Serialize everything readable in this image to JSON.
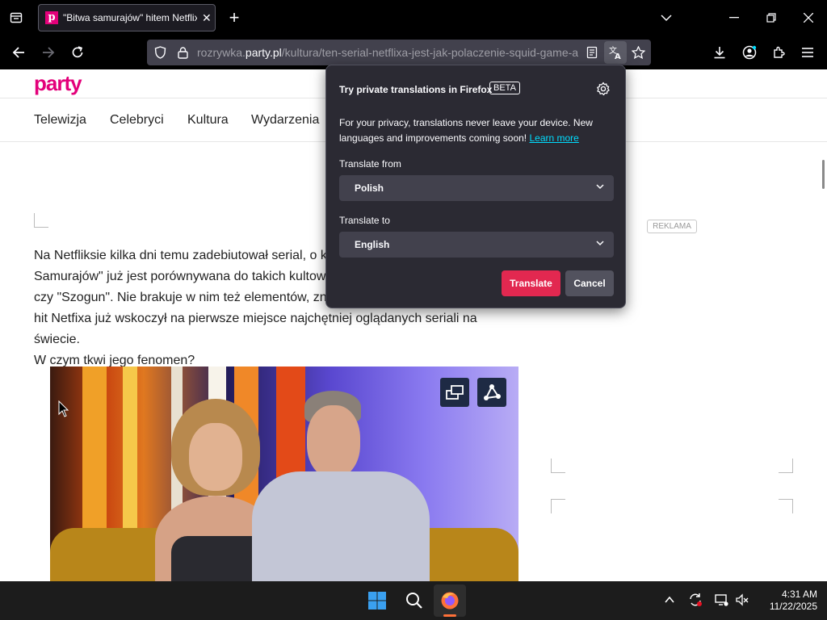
{
  "browser": {
    "tab": {
      "title": "\"Bitwa samurajów\" hitem Netflix",
      "favicon": "p"
    },
    "url": {
      "prefix": "rozrywka.",
      "domain": "party.pl",
      "path": "/kultura/ten-serial-netflixa-jest-jak-polaczenie-squid-game-a"
    }
  },
  "site": {
    "logo": "party",
    "nav": [
      "Telewizja",
      "Celebryci",
      "Kultura",
      "Wydarzenia"
    ],
    "ad_label": "REKLAMA",
    "article_lines": [
      "Na Netfliksie kilka dni temu zadebiutował serial, o k",
      "Samurajów\" już jest porównywana do takich kultow",
      "czy \"Szogun\". Nie brakuje w nim też elementów, zn",
      "hit Netfixa już wskoczył na pierwsze miejsce najchętniej oglądanych seriali na świecie.",
      "W czym tkwi jego fenomen?"
    ]
  },
  "translation_popup": {
    "title": "Try private translations in Firefox",
    "badge": "BETA",
    "description": "For your privacy, translations never leave your device. New languages and improvements coming soon!",
    "learn_more": "Learn more",
    "from_label": "Translate from",
    "from_value": "Polish",
    "to_label": "Translate to",
    "to_value": "English",
    "translate_button": "Translate",
    "cancel_button": "Cancel",
    "accent": "#e22850"
  },
  "taskbar": {
    "time": "4:31 AM",
    "date": "11/22/2025"
  }
}
